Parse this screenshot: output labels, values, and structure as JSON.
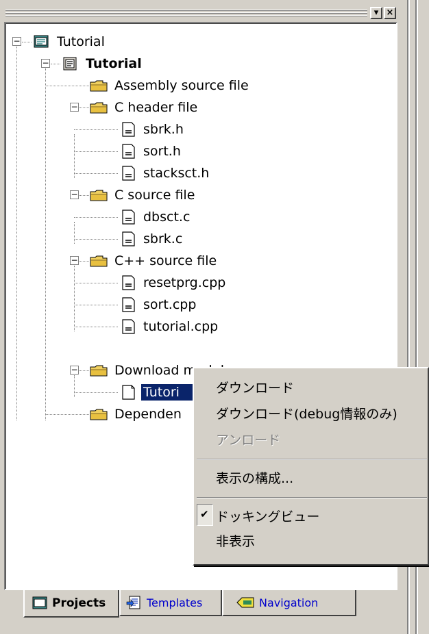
{
  "titlebar": {
    "min_glyph": "▾",
    "close_glyph": "×"
  },
  "tree": {
    "root": "Tutorial",
    "project": "Tutorial",
    "folders": {
      "assembly": "Assembly source file",
      "c_header": "C header file",
      "c_source": "C source file",
      "cpp_source": "C++ source file",
      "download": "Download modules",
      "dependencies": "Dependen"
    },
    "files": {
      "sbrk_h": "sbrk.h",
      "sort_h": "sort.h",
      "stacksct_h": "stacksct.h",
      "dbsct_c": "dbsct.c",
      "sbrk_c": "sbrk.c",
      "resetprg_cpp": "resetprg.cpp",
      "sort_cpp": "sort.cpp",
      "tutorial_cpp": "tutorial.cpp",
      "tutorial_abs": "Tutori"
    }
  },
  "context_menu": {
    "download": "ダウンロード",
    "download_debug": "ダウンロード(debug情報のみ)",
    "unload": "アンロード",
    "configure_view": "表示の構成...",
    "docking_view": "ドッキングビュー",
    "hide": "非表示",
    "checkmark": "✔"
  },
  "tabs": {
    "projects": "Projects",
    "templates": "Templates",
    "navigation": "Navigation"
  },
  "colors": {
    "selection": "#0a246a",
    "folder": "#f0d060",
    "link_blue": "#0000cc"
  }
}
